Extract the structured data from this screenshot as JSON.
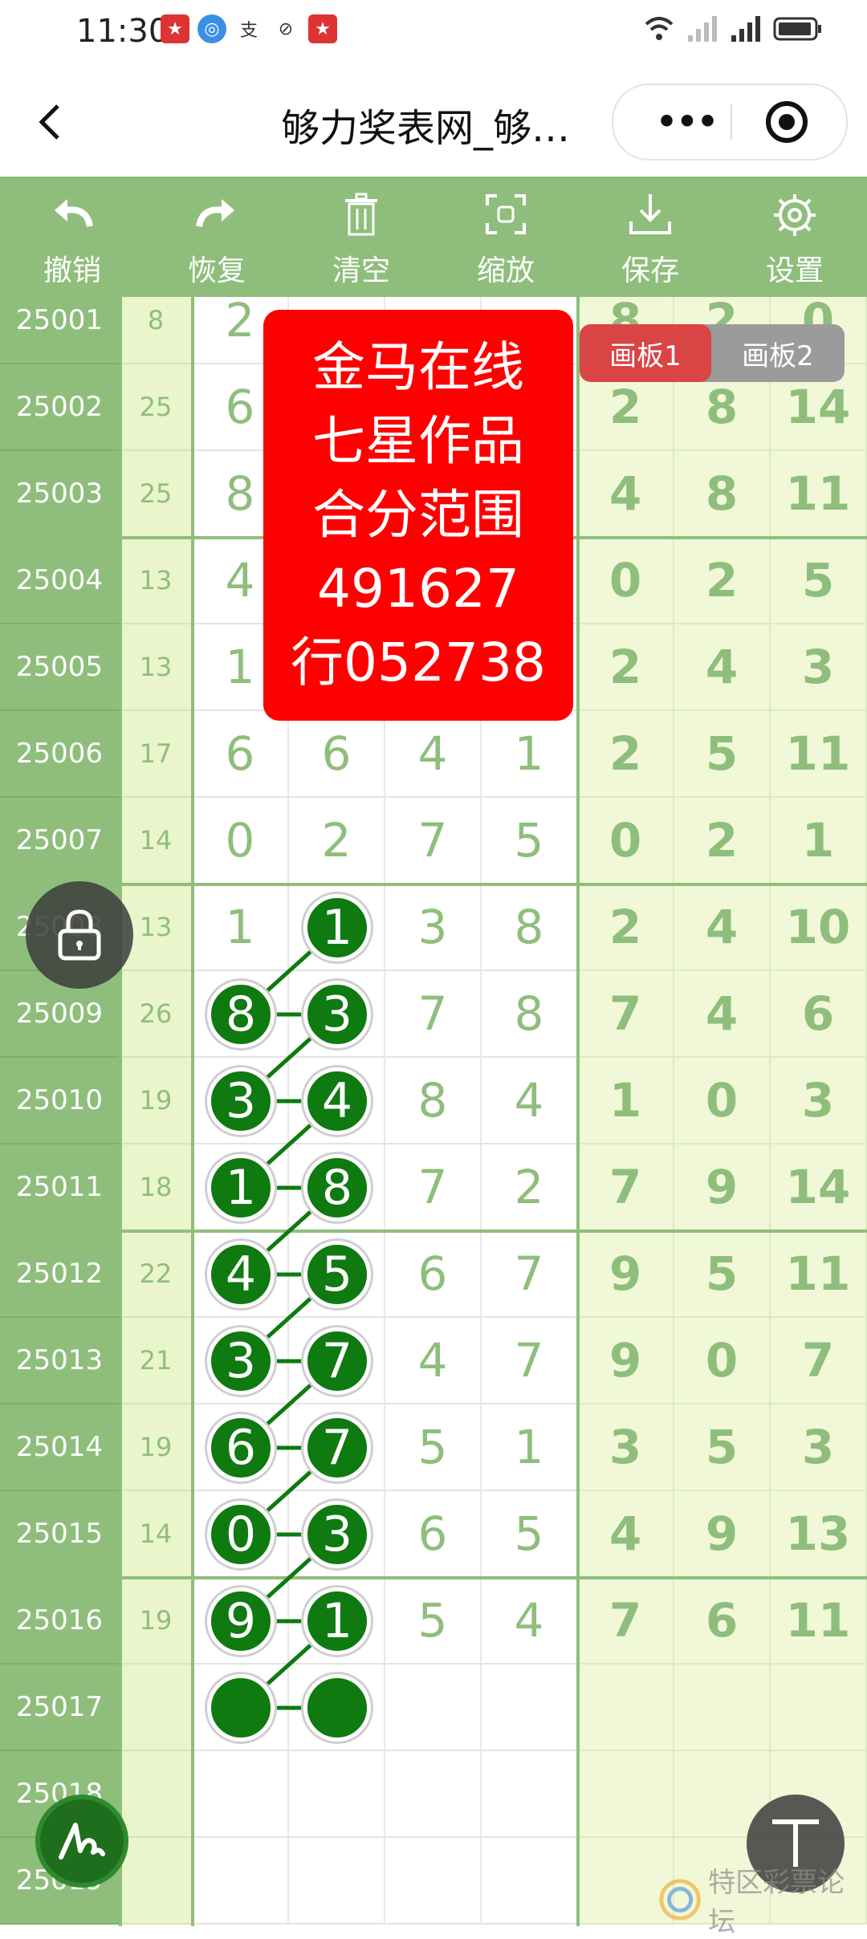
{
  "status": {
    "time": "11:30"
  },
  "nav": {
    "title": "够力奖表网_够…"
  },
  "toolbar": {
    "items": [
      {
        "label": "撤销",
        "icon": "undo-icon"
      },
      {
        "label": "恢复",
        "icon": "redo-icon"
      },
      {
        "label": "清空",
        "icon": "trash-icon"
      },
      {
        "label": "缩放",
        "icon": "zoom-icon"
      },
      {
        "label": "保存",
        "icon": "download-icon"
      },
      {
        "label": "设置",
        "icon": "gear-icon"
      }
    ]
  },
  "overlay": {
    "lines": [
      "金马在线",
      "七星作品",
      "合分范围",
      "491627",
      "行052738"
    ]
  },
  "board_tabs": {
    "tab1": "画板1",
    "tab2": "画板2"
  },
  "rows": [
    {
      "id": "25001",
      "sum": "8",
      "d": [
        "2",
        "",
        "",
        ""
      ],
      "r": [
        "8",
        "2",
        "0"
      ]
    },
    {
      "id": "25002",
      "sum": "25",
      "d": [
        "6",
        "",
        "",
        ""
      ],
      "r": [
        "2",
        "8",
        "14"
      ]
    },
    {
      "id": "25003",
      "sum": "25",
      "d": [
        "8",
        "",
        "",
        ""
      ],
      "r": [
        "4",
        "8",
        "11"
      ]
    },
    {
      "id": "25004",
      "sum": "13",
      "d": [
        "4",
        "",
        "",
        ""
      ],
      "r": [
        "0",
        "2",
        "5"
      ]
    },
    {
      "id": "25005",
      "sum": "13",
      "d": [
        "1",
        "",
        "",
        ""
      ],
      "r": [
        "2",
        "4",
        "3"
      ]
    },
    {
      "id": "25006",
      "sum": "17",
      "d": [
        "6",
        "6",
        "4",
        "1"
      ],
      "r": [
        "2",
        "5",
        "11"
      ]
    },
    {
      "id": "25007",
      "sum": "14",
      "d": [
        "0",
        "2",
        "7",
        "5"
      ],
      "r": [
        "0",
        "2",
        "1"
      ]
    },
    {
      "id": "25008",
      "sum": "13",
      "d": [
        "1",
        "1",
        "3",
        "8"
      ],
      "r": [
        "2",
        "4",
        "10"
      ]
    },
    {
      "id": "25009",
      "sum": "26",
      "d": [
        "8",
        "3",
        "7",
        "8"
      ],
      "r": [
        "7",
        "4",
        "6"
      ]
    },
    {
      "id": "25010",
      "sum": "19",
      "d": [
        "3",
        "4",
        "8",
        "4"
      ],
      "r": [
        "1",
        "0",
        "3"
      ]
    },
    {
      "id": "25011",
      "sum": "18",
      "d": [
        "1",
        "8",
        "7",
        "2"
      ],
      "r": [
        "7",
        "9",
        "14"
      ]
    },
    {
      "id": "25012",
      "sum": "22",
      "d": [
        "4",
        "5",
        "6",
        "7"
      ],
      "r": [
        "9",
        "5",
        "11"
      ]
    },
    {
      "id": "25013",
      "sum": "21",
      "d": [
        "3",
        "7",
        "4",
        "7"
      ],
      "r": [
        "9",
        "0",
        "7"
      ]
    },
    {
      "id": "25014",
      "sum": "19",
      "d": [
        "6",
        "7",
        "5",
        "1"
      ],
      "r": [
        "3",
        "5",
        "3"
      ]
    },
    {
      "id": "25015",
      "sum": "14",
      "d": [
        "0",
        "3",
        "6",
        "5"
      ],
      "r": [
        "4",
        "9",
        "13"
      ]
    },
    {
      "id": "25016",
      "sum": "19",
      "d": [
        "9",
        "1",
        "5",
        "4"
      ],
      "r": [
        "7",
        "6",
        "11"
      ]
    },
    {
      "id": "25017",
      "sum": "",
      "d": [
        "",
        "",
        "",
        ""
      ],
      "r": [
        "",
        "",
        ""
      ]
    },
    {
      "id": "25018",
      "sum": "",
      "d": [
        "",
        "",
        "",
        ""
      ],
      "r": [
        "",
        "",
        ""
      ]
    },
    {
      "id": "25019",
      "sum": "",
      "d": [
        "",
        "",
        "",
        ""
      ],
      "r": [
        "",
        "",
        ""
      ]
    }
  ],
  "balls": [
    {
      "row": 7,
      "col": 1,
      "v": "1"
    },
    {
      "row": 8,
      "col": 0,
      "v": "8"
    },
    {
      "row": 8,
      "col": 1,
      "v": "3"
    },
    {
      "row": 9,
      "col": 0,
      "v": "3"
    },
    {
      "row": 9,
      "col": 1,
      "v": "4"
    },
    {
      "row": 10,
      "col": 0,
      "v": "1"
    },
    {
      "row": 10,
      "col": 1,
      "v": "8"
    },
    {
      "row": 11,
      "col": 0,
      "v": "4"
    },
    {
      "row": 11,
      "col": 1,
      "v": "5"
    },
    {
      "row": 12,
      "col": 0,
      "v": "3"
    },
    {
      "row": 12,
      "col": 1,
      "v": "7"
    },
    {
      "row": 13,
      "col": 0,
      "v": "6"
    },
    {
      "row": 13,
      "col": 1,
      "v": "7"
    },
    {
      "row": 14,
      "col": 0,
      "v": "0"
    },
    {
      "row": 14,
      "col": 1,
      "v": "3"
    },
    {
      "row": 15,
      "col": 0,
      "v": "9"
    },
    {
      "row": 15,
      "col": 1,
      "v": "1"
    },
    {
      "row": 16,
      "col": 0,
      "v": ""
    },
    {
      "row": 16,
      "col": 1,
      "v": ""
    }
  ],
  "watermark": {
    "text": "特区彩票论坛"
  }
}
